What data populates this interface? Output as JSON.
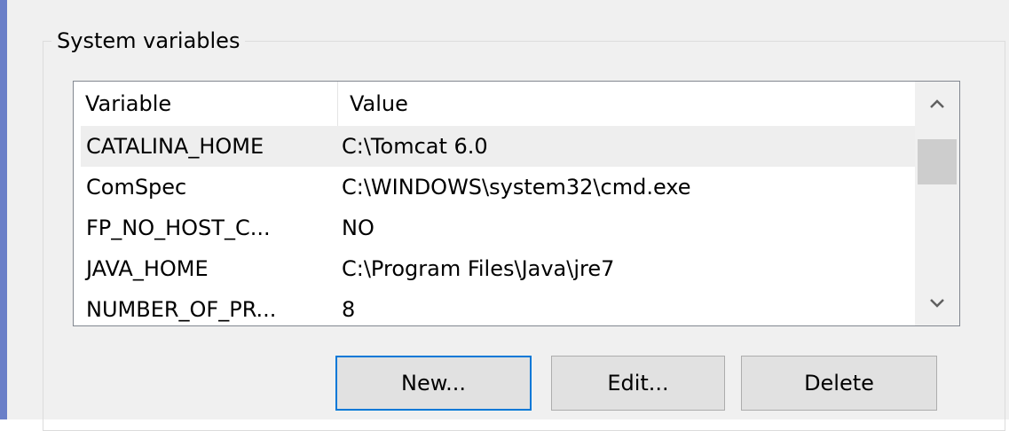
{
  "group": {
    "title": "System variables"
  },
  "list": {
    "columns": {
      "variable": "Variable",
      "value": "Value"
    },
    "rows": [
      {
        "variable": "CATALINA_HOME",
        "value": "C:\\Tomcat 6.0",
        "selected": true
      },
      {
        "variable": "ComSpec",
        "value": "C:\\WINDOWS\\system32\\cmd.exe",
        "selected": false
      },
      {
        "variable": "FP_NO_HOST_C...",
        "value": "NO",
        "selected": false
      },
      {
        "variable": "JAVA_HOME",
        "value": "C:\\Program Files\\Java\\jre7",
        "selected": false
      },
      {
        "variable": "NUMBER_OF_PR...",
        "value": "8",
        "selected": false
      }
    ]
  },
  "buttons": {
    "new": "New...",
    "edit": "Edit...",
    "delete": "Delete"
  },
  "icons": {
    "scroll_up": "chevron-up-icon",
    "scroll_down": "chevron-down-icon"
  },
  "colors": {
    "accent": "#6a7fc8",
    "default_button_border": "#0078d7",
    "selected_row": "#eeeeee"
  }
}
